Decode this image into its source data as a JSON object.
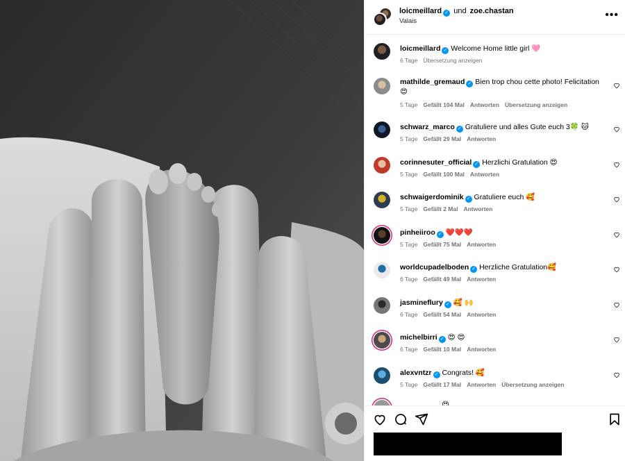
{
  "post": {
    "author": "loicmeillard",
    "conjunction": "und",
    "collaborator": "zoe.chastan",
    "location": "Valais",
    "more_label": "•••"
  },
  "caption": {
    "user": "loicmeillard",
    "text": "Welcome Home little girl 🩷",
    "time": "6 Tage",
    "translate": "Übersetzung anzeigen"
  },
  "comments": [
    {
      "user": "mathilde_gremaud",
      "text": "Bien trop chou cette photo! Felicitation",
      "text2": "😍",
      "time": "5 Tage",
      "likes": "Gefällt 104 Mal",
      "reply": "Antworten",
      "translate": "Übersetzung anzeigen"
    },
    {
      "user": "schwarz_marco",
      "text": "Gratuliere und alles Gute euch 3🍀 🐱",
      "time": "5 Tage",
      "likes": "Gefällt 29 Mal",
      "reply": "Antworten"
    },
    {
      "user": "corinnesuter_official",
      "text": "Herzlichi Gratulation 😍",
      "time": "5 Tage",
      "likes": "Gefällt 100 Mal",
      "reply": "Antworten"
    },
    {
      "user": "schwaigerdominik",
      "text": "Gratuliere euch 🥰",
      "time": "5 Tage",
      "likes": "Gefällt 2 Mal",
      "reply": "Antworten"
    },
    {
      "user": "pinheiiroo",
      "text": "❤️❤️❤️",
      "time": "5 Tage",
      "likes": "Gefällt 75 Mal",
      "reply": "Antworten"
    },
    {
      "user": "worldcupadelboden",
      "text": "Herzliche Gratulation🥰",
      "time": "6 Tage",
      "likes": "Gefällt 49 Mal",
      "reply": "Antworten"
    },
    {
      "user": "jasmineflury",
      "text": "🥰 🙌",
      "time": "6 Tage",
      "likes": "Gefällt 54 Mal",
      "reply": "Antworten"
    },
    {
      "user": "michelbirri",
      "text": "😍 😍",
      "time": "6 Tage",
      "likes": "Gefällt 10 Mal",
      "reply": "Antworten"
    },
    {
      "user": "alexvntzr",
      "text": "Congrats! 🥰",
      "time": "5 Tage",
      "likes": "Gefällt 17 Mal",
      "reply": "Antworten",
      "translate": "Übersetzung anzeigen"
    }
  ],
  "partial_comment": {
    "text": "😍"
  },
  "icons": {
    "like": "heart-icon",
    "comment": "comment-icon",
    "share": "share-icon",
    "save": "bookmark-icon",
    "verified": "verified-badge-icon"
  },
  "colors": {
    "verified": "#0095f6",
    "meta": "#737373",
    "story_ring": "#d62976"
  }
}
